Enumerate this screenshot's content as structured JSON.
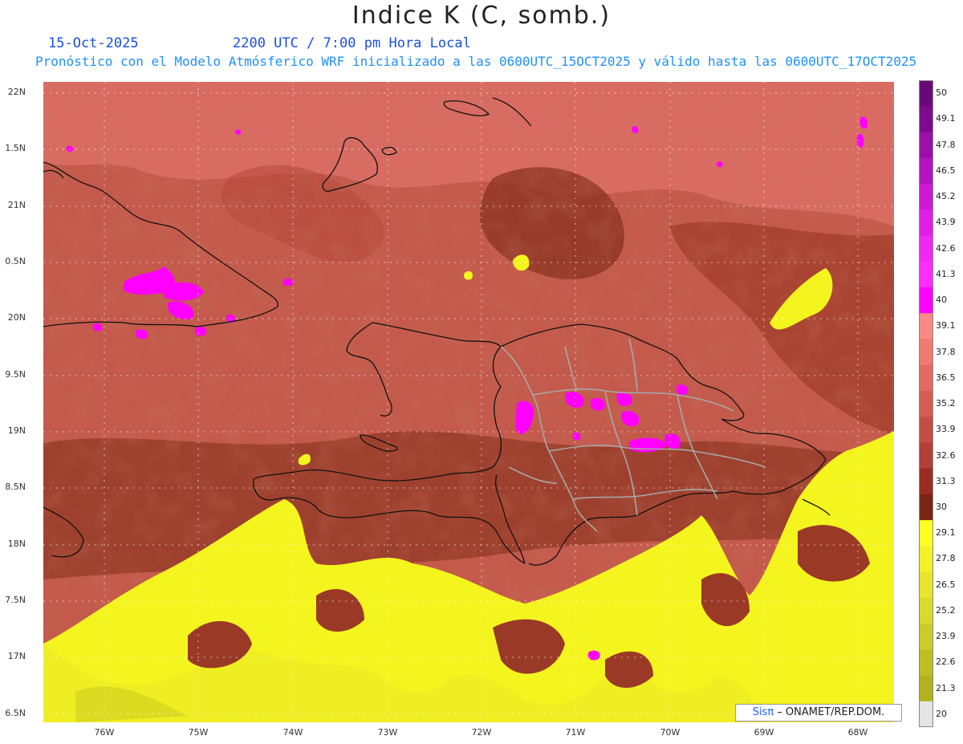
{
  "title": "Indice K (C, somb.)",
  "date": "15-Oct-2025",
  "time_label": "2200 UTC / 7:00 pm Hora Local",
  "forecast_line": "Pronóstico con el Modelo Atmósferico WRF inicializado a las 0600UTC_15OCT2025 y válido hasta las  0600UTC_17OCT2025",
  "lat_labels": [
    "22N",
    "1.5N",
    "21N",
    "0.5N",
    "20N",
    "9.5N",
    "19N",
    "8.5N",
    "18N",
    "7.5N",
    "17N",
    "6.5N"
  ],
  "lon_labels": [
    "76W",
    "75W",
    "74W",
    "73W",
    "72W",
    "71W",
    "70W",
    "69W",
    "68W"
  ],
  "colorbar_labels": [
    "50",
    "49.1",
    "47.8",
    "46.5",
    "45.2",
    "43.9",
    "42.6",
    "41.3",
    "40",
    "39.1",
    "37.8",
    "36.5",
    "35.2",
    "33.9",
    "32.6",
    "31.3",
    "30",
    "29.1",
    "27.8",
    "26.5",
    "25.2",
    "23.9",
    "22.6",
    "21.3",
    "20"
  ],
  "colorbar_colors": [
    "#6a0a7a",
    "#7e0a8e",
    "#9a10a8",
    "#b414c0",
    "#cc18d6",
    "#e01ee8",
    "#f028f4",
    "#ff2eff",
    "#ff00ff",
    "#f78a84",
    "#ee7a70",
    "#e36a60",
    "#d45e52",
    "#c44e44",
    "#b24038",
    "#9a2c22",
    "#7a2414",
    "#ffff22",
    "#f2f228",
    "#e6e62a",
    "#dada2c",
    "#cccc28",
    "#bebe22",
    "#b2b21e",
    "#e4e4e4"
  ],
  "credit_brand": "Sisπ",
  "credit_text": " – ONAMET/REP.DOM."
}
